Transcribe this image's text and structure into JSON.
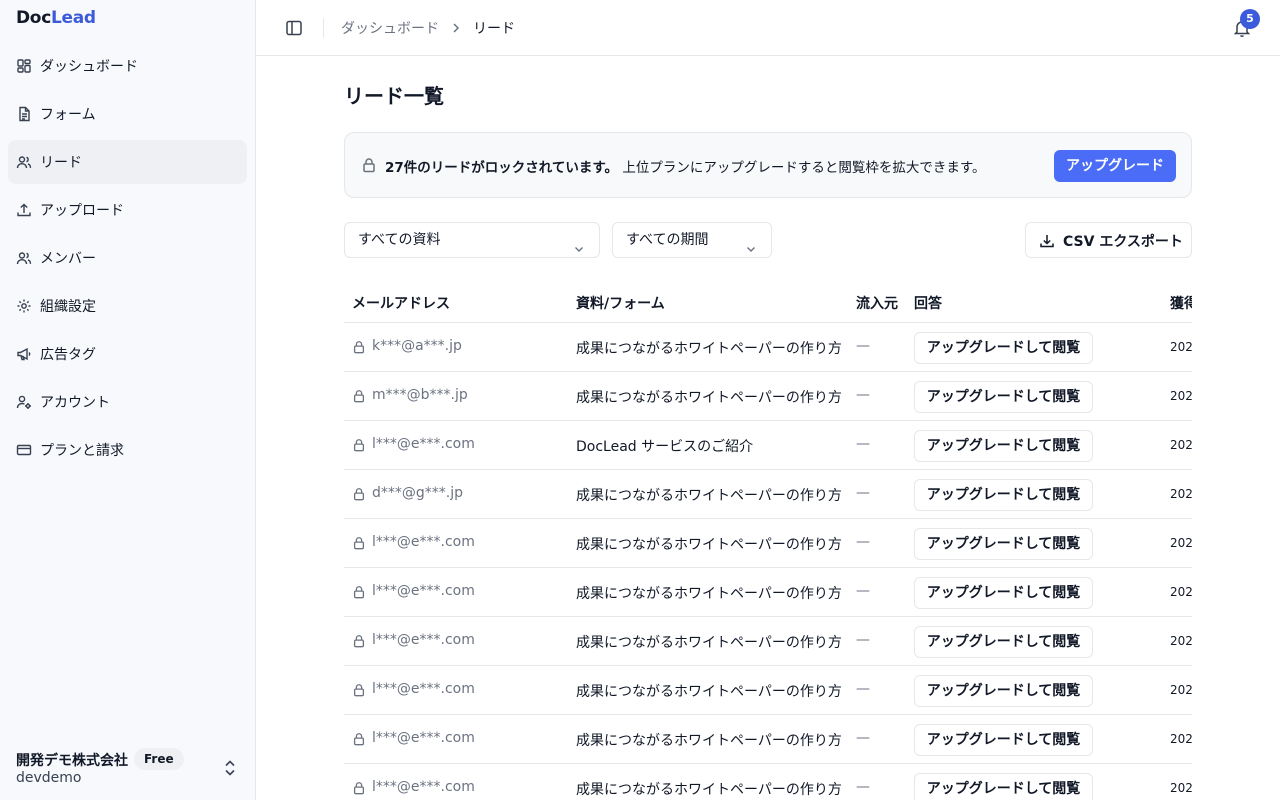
{
  "app": {
    "logo_part1": "Doc",
    "logo_part2": "Lead"
  },
  "sidebar": {
    "items": [
      {
        "label": "ダッシュボード",
        "icon": "dashboard-icon"
      },
      {
        "label": "フォーム",
        "icon": "file-text-icon"
      },
      {
        "label": "リード",
        "icon": "users-icon",
        "active": true
      },
      {
        "label": "アップロード",
        "icon": "upload-icon"
      },
      {
        "label": "メンバー",
        "icon": "users-icon"
      },
      {
        "label": "組織設定",
        "icon": "gear-icon"
      },
      {
        "label": "広告タグ",
        "icon": "megaphone-icon"
      },
      {
        "label": "アカウント",
        "icon": "user-cog-icon"
      },
      {
        "label": "プランと請求",
        "icon": "credit-card-icon"
      }
    ],
    "org": {
      "name": "開発デモ株式会社",
      "plan": "Free",
      "user": "devdemo"
    }
  },
  "header": {
    "breadcrumb": [
      "ダッシュボード",
      "リード"
    ],
    "notification_count": "5"
  },
  "main": {
    "title": "リード一覧",
    "banner": {
      "bold": "27件のリードがロックされています。",
      "text": " 上位プランにアップグレードすると閲覧枠を拡大できます。",
      "button": "アップグレード"
    },
    "filters": {
      "doc": "すべての資料",
      "period": "すべての期間"
    },
    "csv_button": "CSV エクスポート",
    "table": {
      "headers": [
        "メールアドレス",
        "資料/フォーム",
        "流入元",
        "回答",
        "獲得"
      ],
      "rows": [
        {
          "email": "k***@a***.jp",
          "doc": "成果につながるホワイトペーパーの作り方",
          "source": "—",
          "action": "アップグレードして閲覧",
          "date": "202"
        },
        {
          "email": "m***@b***.jp",
          "doc": "成果につながるホワイトペーパーの作り方",
          "source": "—",
          "action": "アップグレードして閲覧",
          "date": "202"
        },
        {
          "email": "l***@e***.com",
          "doc": "DocLead サービスのご紹介",
          "source": "—",
          "action": "アップグレードして閲覧",
          "date": "202"
        },
        {
          "email": "d***@g***.jp",
          "doc": "成果につながるホワイトペーパーの作り方",
          "source": "—",
          "action": "アップグレードして閲覧",
          "date": "202"
        },
        {
          "email": "l***@e***.com",
          "doc": "成果につながるホワイトペーパーの作り方",
          "source": "—",
          "action": "アップグレードして閲覧",
          "date": "202"
        },
        {
          "email": "l***@e***.com",
          "doc": "成果につながるホワイトペーパーの作り方",
          "source": "—",
          "action": "アップグレードして閲覧",
          "date": "202"
        },
        {
          "email": "l***@e***.com",
          "doc": "成果につながるホワイトペーパーの作り方",
          "source": "—",
          "action": "アップグレードして閲覧",
          "date": "202"
        },
        {
          "email": "l***@e***.com",
          "doc": "成果につながるホワイトペーパーの作り方",
          "source": "—",
          "action": "アップグレードして閲覧",
          "date": "202"
        },
        {
          "email": "l***@e***.com",
          "doc": "成果につながるホワイトペーパーの作り方",
          "source": "—",
          "action": "アップグレードして閲覧",
          "date": "202"
        },
        {
          "email": "l***@e***.com",
          "doc": "成果につながるホワイトペーパーの作り方",
          "source": "—",
          "action": "アップグレードして閲覧",
          "date": "202"
        }
      ]
    }
  },
  "colors": {
    "accent": "#4a6cf7",
    "brand": "#3b5bdb",
    "sidebar_bg": "#f8f9fc"
  }
}
